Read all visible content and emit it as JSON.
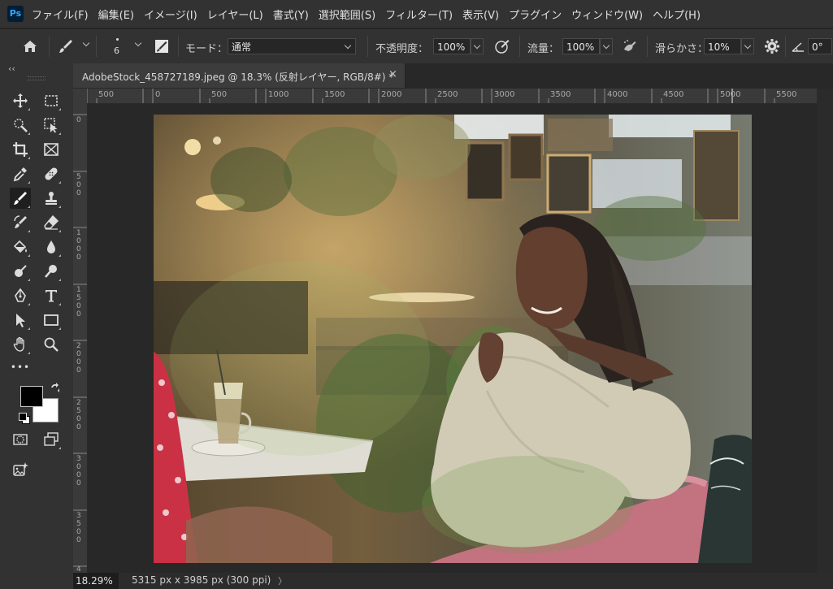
{
  "app": {
    "logo": "Ps"
  },
  "menu": [
    "ファイル(F)",
    "編集(E)",
    "イメージ(I)",
    "レイヤー(L)",
    "書式(Y)",
    "選択範囲(S)",
    "フィルター(T)",
    "表示(V)",
    "プラグイン",
    "ウィンドウ(W)",
    "ヘルプ(H)"
  ],
  "options": {
    "brush_size": "6",
    "mode_label": "モード：",
    "mode_value": "通常",
    "opacity_label": "不透明度：",
    "opacity_value": "100%",
    "flow_label": "流量：",
    "flow_value": "100%",
    "smoothing_label": "滑らかさ：",
    "smoothing_value": "10%",
    "angle_value": "0°"
  },
  "toolbar": {
    "collapse": "‹‹",
    "more": "•••"
  },
  "document": {
    "tab_title": "AdobeStock_458727189.jpeg @ 18.3% (反射レイヤー, RGB/8#) *",
    "tab_close": "×",
    "active_tool": "brush-tool"
  },
  "rulers": {
    "top": [
      "500",
      "0",
      "500",
      "1000",
      "1500",
      "2000",
      "2500",
      "3000",
      "3500",
      "4000",
      "4500",
      "5000",
      "5500"
    ],
    "left": [
      "0",
      "500",
      "1000",
      "1500",
      "2000",
      "2500",
      "3000",
      "3500",
      "4"
    ]
  },
  "status": {
    "zoom": "18.29%",
    "doc_info": "5315 px x 3985 px (300 ppi)",
    "arrow": "〉"
  },
  "colors": {
    "foreground": "#000000",
    "background": "#ffffff",
    "ui_dark": "#323232",
    "canvas": "#282828"
  }
}
